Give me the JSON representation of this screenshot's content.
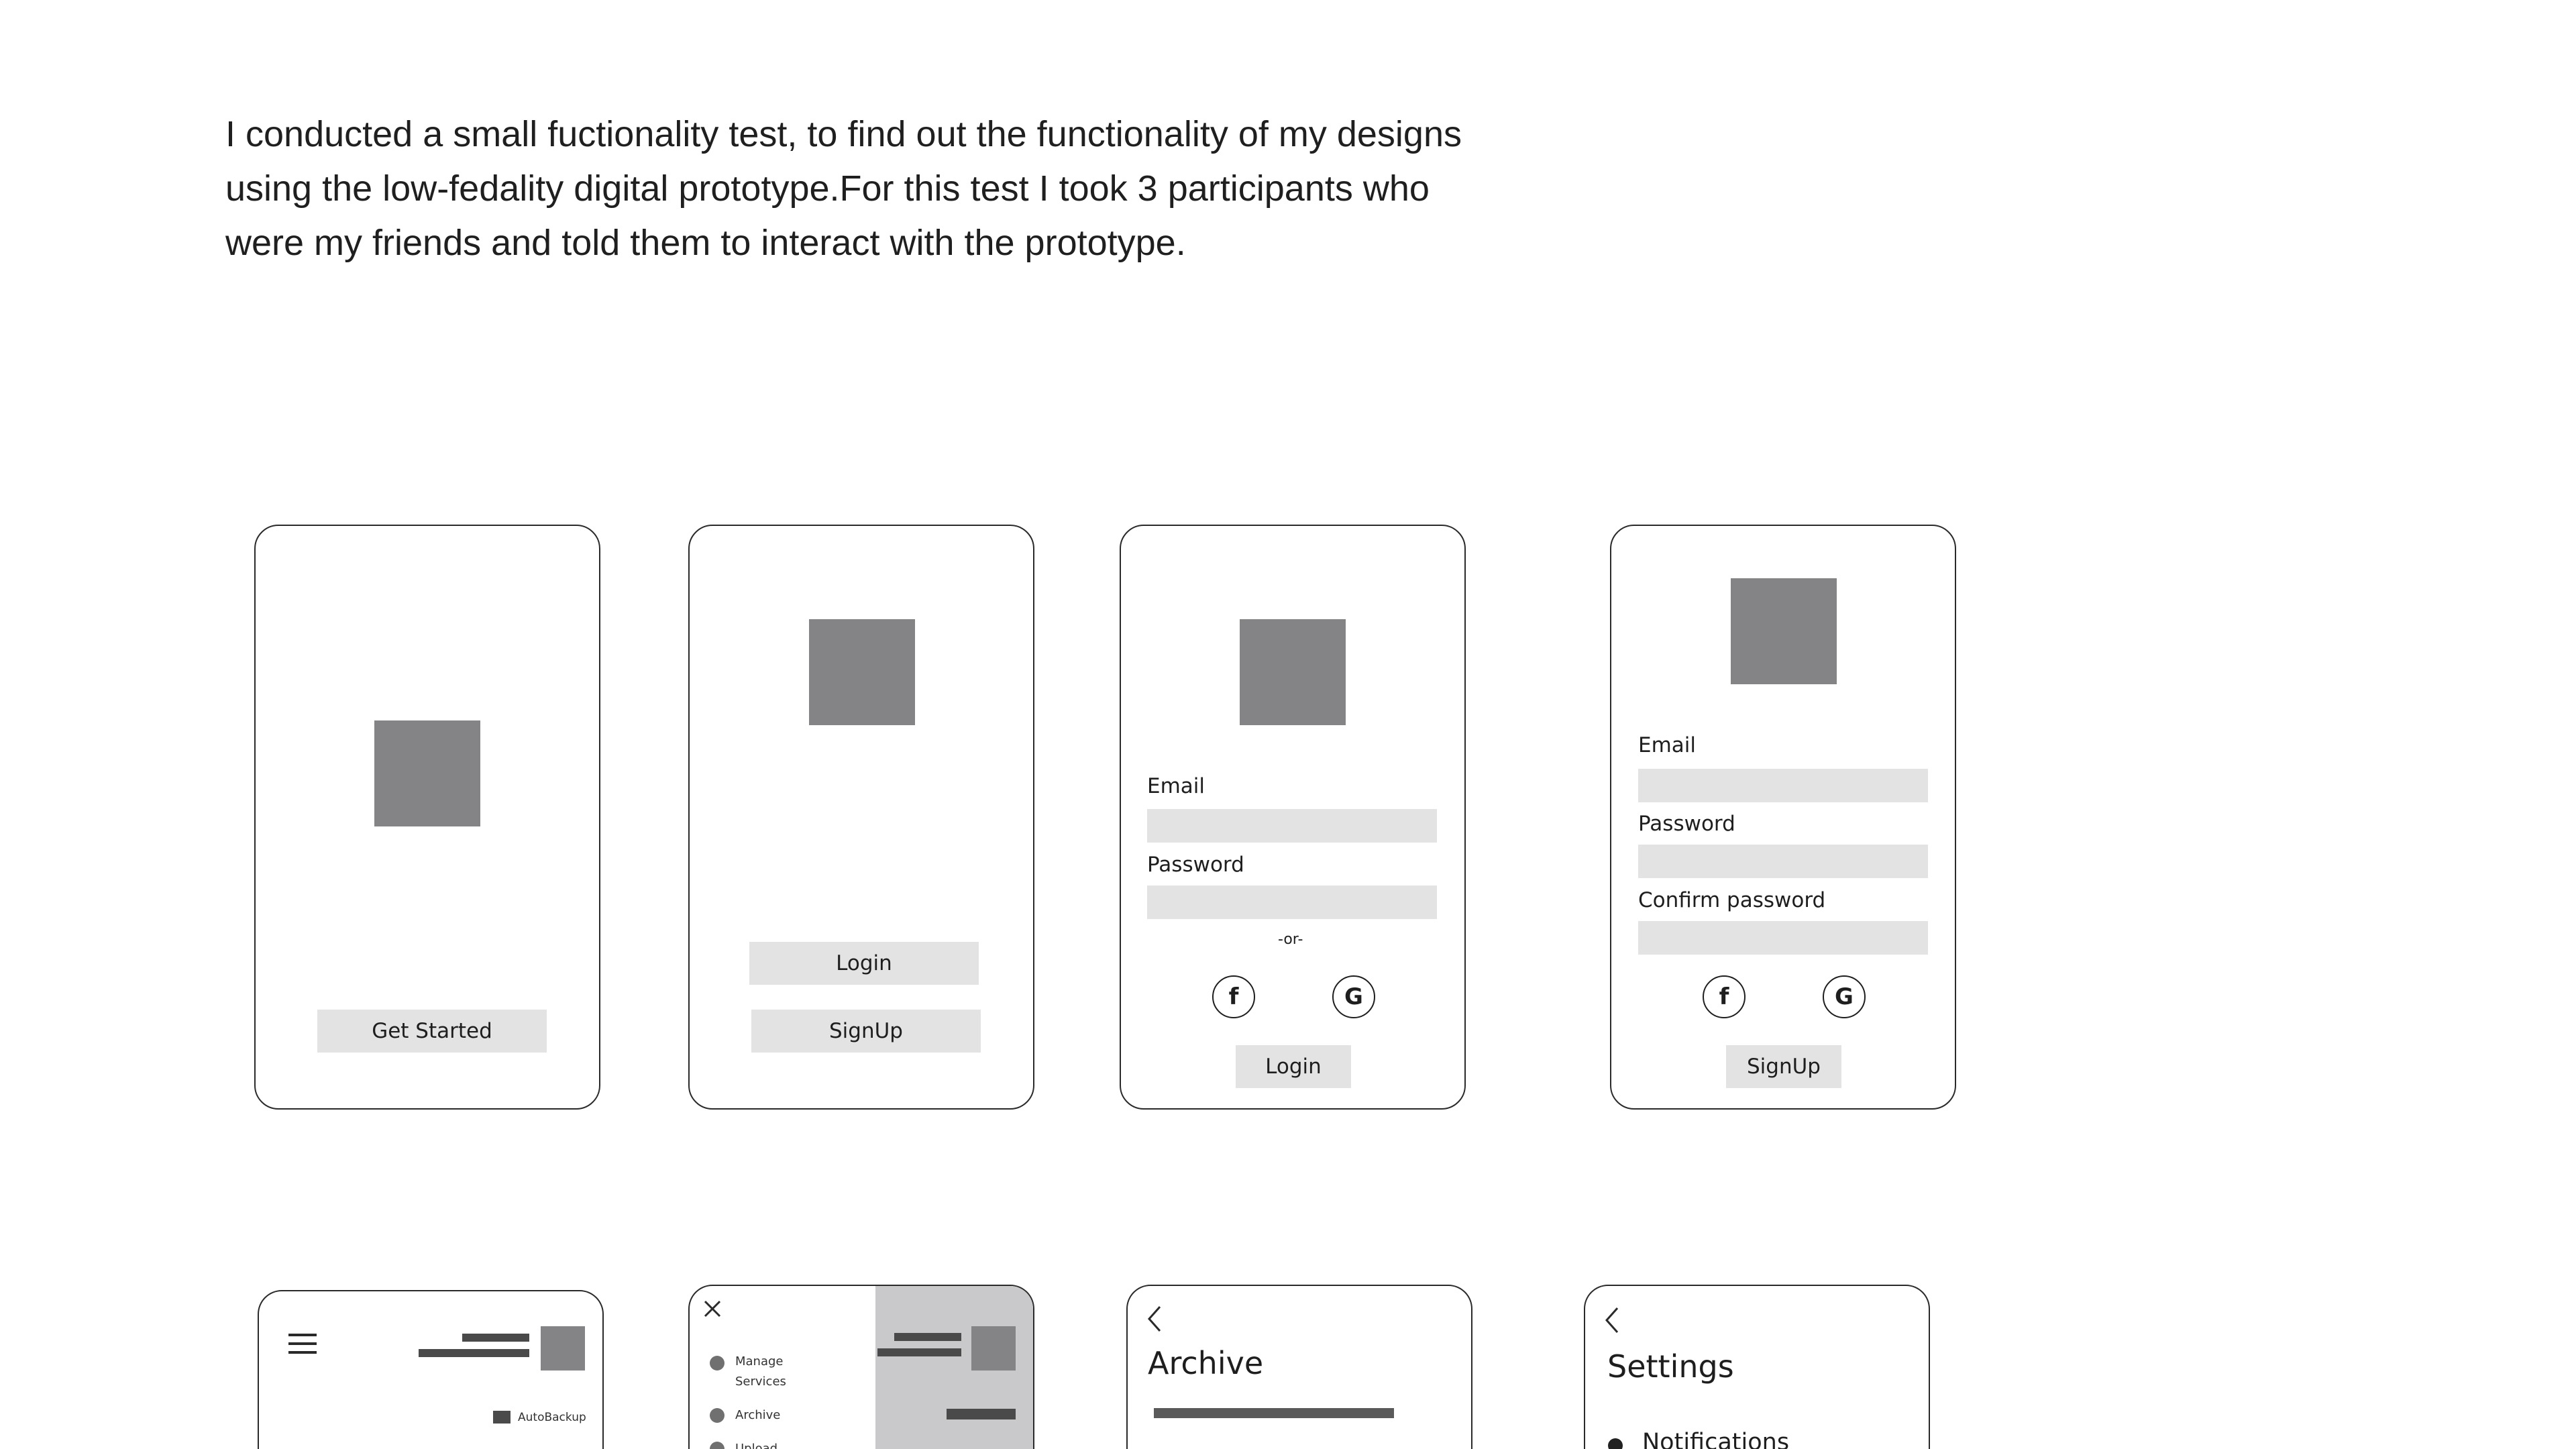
{
  "intro": {
    "text": "I conducted a small fuctionality test, to find out the functionality of my designs\nusing the low-fedality digital prototype.For this test I took 3 participants who\nwere my friends and told them to interact with the prototype."
  },
  "screen_splash": {
    "button": "Get Started"
  },
  "screen_welcome": {
    "login_button": "Login",
    "signup_button": "SignUp"
  },
  "screen_login": {
    "email_label": "Email",
    "password_label": "Password",
    "divider": "-or-",
    "facebook_glyph": "f",
    "google_glyph": "G",
    "login_button": "Login"
  },
  "screen_signup": {
    "email_label": "Email",
    "password_label": "Password",
    "confirm_label": "Confirm password",
    "facebook_glyph": "f",
    "google_glyph": "G",
    "signup_button": "SignUp"
  },
  "screen_home": {
    "autobackup": "AutoBackup",
    "menu_icon": "hamburger-menu-icon"
  },
  "screen_drawer": {
    "items": [
      {
        "label": "Manage\nServices"
      },
      {
        "label": "Archive"
      },
      {
        "label": "Upload"
      }
    ],
    "close_icon": "close-icon"
  },
  "screen_archive": {
    "title": "Archive",
    "back_icon": "chevron-left-icon"
  },
  "screen_settings": {
    "title": "Settings",
    "first_item": "Notifications",
    "back_icon": "chevron-left-icon"
  },
  "colors": {
    "placeholder_gray": "#848487",
    "field_gray": "#e3e3e3",
    "overlay_gray": "#c9c9cb",
    "bar_dark": "#4a4a4a"
  }
}
